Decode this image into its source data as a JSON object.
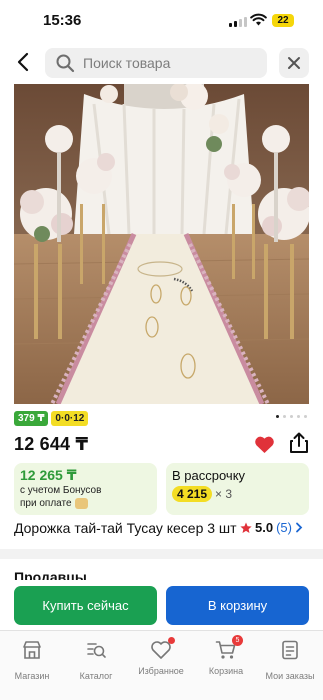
{
  "status_bar": {
    "time": "15:36",
    "battery": "22"
  },
  "search": {
    "placeholder": "Поиск товара"
  },
  "product": {
    "image_alt": "Дорожка тай-тай Тусау кесер",
    "badge_installment": "379 ₸",
    "badge_plan": "0·0·12",
    "gallery_count": 5,
    "gallery_active": 0,
    "price": "12 644 ₸",
    "title": "Дорожка тай-тай Тусау кесер 3 шт",
    "rating": "5.0",
    "reviews": "(5)"
  },
  "bonus_card": {
    "price": "12 265 ₸",
    "line1": "с учетом Бонусов",
    "line2": "при оплате"
  },
  "installment_card": {
    "title": "В рассрочку",
    "amount": "4 215",
    "multiplier": "× 3"
  },
  "sellers": {
    "heading": "Продавцы"
  },
  "actions": {
    "buy_now": "Купить сейчас",
    "add_to_cart": "В корзину"
  },
  "tabbar": {
    "items": [
      {
        "label": "Магазин",
        "icon": "shop-icon"
      },
      {
        "label": "Каталог",
        "icon": "catalog-search-icon"
      },
      {
        "label": "Избранное",
        "icon": "heart-outline-icon"
      },
      {
        "label": "Корзина",
        "icon": "cart-icon",
        "badge": "5"
      },
      {
        "label": "Мои заказы",
        "icon": "orders-icon"
      }
    ]
  },
  "colors": {
    "buy": "#1aa052",
    "cart": "#1765d1",
    "heart": "#e0323a",
    "bonus_green": "#2f9a3a",
    "badge_yellow": "#f3dd24",
    "rating_link": "#1a66d2"
  }
}
